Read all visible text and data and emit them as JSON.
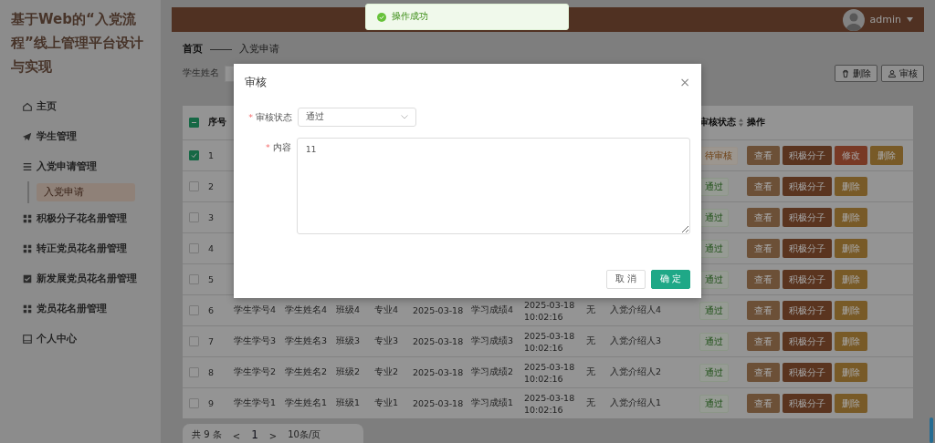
{
  "sidebar": {
    "title": "基于Web的“入党流程”线上管理平台设计与实现",
    "items": [
      {
        "label": "主页"
      },
      {
        "label": "学生管理"
      },
      {
        "label": "入党申请管理",
        "children": [
          {
            "label": "入党申请",
            "selected": true
          }
        ]
      },
      {
        "label": "积极分子花名册管理"
      },
      {
        "label": "转正党员花名册管理"
      },
      {
        "label": "新发展党员花名册管理"
      },
      {
        "label": "党员花名册管理"
      },
      {
        "label": "个人中心"
      }
    ]
  },
  "topbar": {
    "user": "admin"
  },
  "toast": {
    "message": "操作成功",
    "kind": "success"
  },
  "breadcrumb": [
    "首页",
    "入党申请"
  ],
  "search": {
    "label": "学生姓名"
  },
  "toolbar": [
    {
      "label": "删除",
      "kind": "delete"
    },
    {
      "label": "审核",
      "kind": "review"
    }
  ],
  "table": {
    "indeterminate": true,
    "columns": [
      {
        "kind": "index",
        "label": "序号",
        "sortable": false
      },
      {
        "kind": "status",
        "label": "审核状态",
        "sortable": true
      },
      {
        "kind": "actions",
        "label": "操作",
        "sortable": false
      }
    ],
    "rows": [
      {
        "checked": true,
        "index": "1",
        "status": {
          "label": "待审核",
          "kind": "pending"
        },
        "actions": [
          {
            "label": "查看",
            "kind": "view"
          },
          {
            "label": "积极分子",
            "kind": "promote"
          },
          {
            "label": "修改",
            "kind": "edit"
          },
          {
            "label": "删除",
            "kind": "delete"
          }
        ]
      },
      {
        "checked": false,
        "index": "2",
        "status": {
          "label": "通过",
          "kind": "passed"
        },
        "actions": [
          {
            "label": "查看",
            "kind": "view"
          },
          {
            "label": "积极分子",
            "kind": "promote"
          },
          {
            "label": "删除",
            "kind": "delete"
          }
        ]
      },
      {
        "checked": false,
        "index": "3",
        "status": {
          "label": "通过",
          "kind": "passed"
        },
        "actions": [
          {
            "label": "查看",
            "kind": "view"
          },
          {
            "label": "积极分子",
            "kind": "promote"
          },
          {
            "label": "删除",
            "kind": "delete"
          }
        ]
      },
      {
        "checked": false,
        "index": "4",
        "status": {
          "label": "通过",
          "kind": "passed"
        },
        "actions": [
          {
            "label": "查看",
            "kind": "view"
          },
          {
            "label": "积极分子",
            "kind": "promote"
          },
          {
            "label": "删除",
            "kind": "delete"
          }
        ]
      },
      {
        "checked": false,
        "index": "5",
        "status": {
          "label": "通过",
          "kind": "passed"
        },
        "actions": [
          {
            "label": "查看",
            "kind": "view"
          },
          {
            "label": "积极分子",
            "kind": "promote"
          },
          {
            "label": "删除",
            "kind": "delete"
          }
        ]
      },
      {
        "checked": false,
        "index": "6",
        "student_id": "学生学号4",
        "name": "学生姓名4",
        "class": "班级4",
        "major": "专业4",
        "date": "2025-03-18",
        "grade": "学习成绩4",
        "time": "2025-03-18 10:02:16",
        "column_10": "无",
        "introducer": "入党介绍人4",
        "status": {
          "label": "通过",
          "kind": "passed"
        },
        "actions": [
          {
            "label": "查看",
            "kind": "view"
          },
          {
            "label": "积极分子",
            "kind": "promote"
          },
          {
            "label": "删除",
            "kind": "delete"
          }
        ]
      },
      {
        "checked": false,
        "index": "7",
        "student_id": "学生学号3",
        "name": "学生姓名3",
        "class": "班级3",
        "major": "专业3",
        "date": "2025-03-18",
        "grade": "学习成绩3",
        "time": "2025-03-18 10:02:16",
        "column_10": "无",
        "introducer": "入党介绍人3",
        "status": {
          "label": "通过",
          "kind": "passed"
        },
        "actions": [
          {
            "label": "查看",
            "kind": "view"
          },
          {
            "label": "积极分子",
            "kind": "promote"
          },
          {
            "label": "删除",
            "kind": "delete"
          }
        ]
      },
      {
        "checked": false,
        "index": "8",
        "student_id": "学生学号2",
        "name": "学生姓名2",
        "class": "班级2",
        "major": "专业2",
        "date": "2025-03-18",
        "grade": "学习成绩2",
        "time": "2025-03-18 10:02:16",
        "column_10": "无",
        "introducer": "入党介绍人2",
        "status": {
          "label": "通过",
          "kind": "passed"
        },
        "actions": [
          {
            "label": "查看",
            "kind": "view"
          },
          {
            "label": "积极分子",
            "kind": "promote"
          },
          {
            "label": "删除",
            "kind": "delete"
          }
        ]
      },
      {
        "checked": false,
        "index": "9",
        "student_id": "学生学号1",
        "name": "学生姓名1",
        "class": "班级1",
        "major": "专业1",
        "date": "2025-03-18",
        "grade": "学习成绩1",
        "time": "2025-03-18 10:02:16",
        "column_10": "无",
        "introducer": "入党介绍人1",
        "status": {
          "label": "通过",
          "kind": "passed"
        },
        "actions": [
          {
            "label": "查看",
            "kind": "view"
          },
          {
            "label": "积极分子",
            "kind": "promote"
          },
          {
            "label": "删除",
            "kind": "delete"
          }
        ]
      }
    ]
  },
  "pagination": {
    "total": "共 9 条",
    "prev": "<",
    "page": "1",
    "next": ">",
    "page_size": "10条/页"
  },
  "modal": {
    "title": "审核",
    "close": "×",
    "fields": [
      {
        "kind": "select",
        "required_mark": "*",
        "label": "审核状态",
        "value": "通过"
      },
      {
        "kind": "textarea",
        "required_mark": "*",
        "label": "内容",
        "value": "11"
      }
    ],
    "buttons": [
      {
        "label": "取 消",
        "kind": "default"
      },
      {
        "label": "确 定",
        "kind": "primary"
      }
    ]
  }
}
